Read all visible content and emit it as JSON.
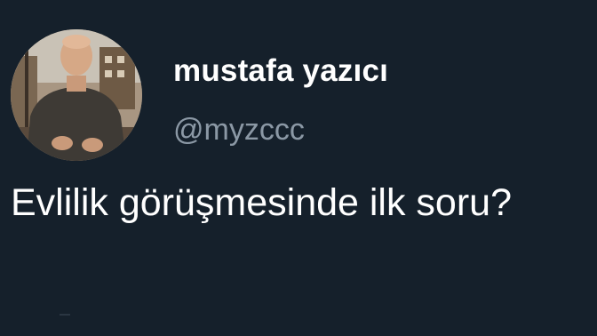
{
  "tweet": {
    "display_name": "mustafa yazıcı",
    "handle": "@myzccc",
    "text": "Evlilik görüşmesinde ilk soru?",
    "avatar_icon": "profile-photo"
  },
  "colors": {
    "background": "#15202b",
    "name": "#ffffff",
    "handle": "#8b98a5",
    "text": "#ffffff"
  }
}
